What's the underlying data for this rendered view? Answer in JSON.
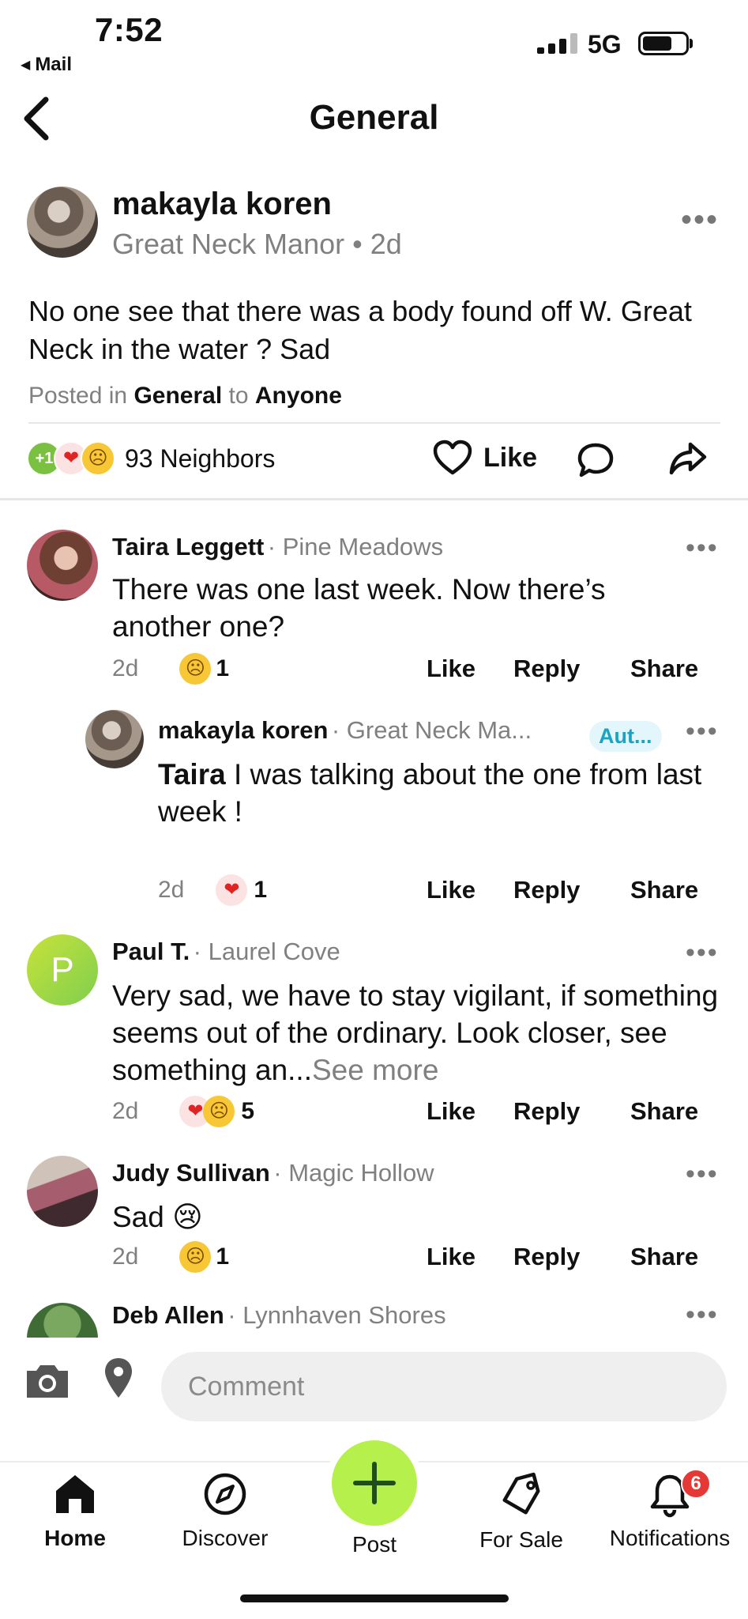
{
  "status_bar": {
    "time": "7:52",
    "back_app": "Mail",
    "network": "5G"
  },
  "header": {
    "title": "General"
  },
  "post": {
    "author": "makayla koren",
    "neighborhood": "Great Neck Manor",
    "age": "2d",
    "body": "No one see that there was a body found off W. Great Neck in the water ? Sad",
    "posted_in_prefix": "Posted in",
    "posted_in_group": "General",
    "posted_to_prefix": "to",
    "audience": "Anyone",
    "reaction_plus": "+1",
    "neighbors_label": "93 Neighbors",
    "like_label": "Like"
  },
  "comments": [
    {
      "name": "Taira Leggett",
      "neighborhood": "· Pine Meadows",
      "text": "There was one last week. Now there’s another one?",
      "age": "2d",
      "reaction_count": "1",
      "like": "Like",
      "reply": "Reply",
      "share": "Share"
    },
    {
      "name": "makayla koren",
      "neighborhood": "· Great Neck Ma...",
      "badge": "Aut...",
      "mention": "Taira",
      "text": " I was talking about the one from last week !",
      "age": "2d",
      "reaction_count": "1",
      "like": "Like",
      "reply": "Reply",
      "share": "Share"
    },
    {
      "name": "Paul T.",
      "neighborhood": "· Laurel Cove",
      "avatar_letter": "P",
      "text": "Very sad, we have to stay vigilant,  if something seems out of the ordinary. Look closer, see something an...",
      "see_more": "See more",
      "age": "2d",
      "reaction_count": "5",
      "like": "Like",
      "reply": "Reply",
      "share": "Share"
    },
    {
      "name": "Judy Sullivan",
      "neighborhood": "· Magic Hollow",
      "text": "Sad 😢",
      "age": "2d",
      "reaction_count": "1",
      "like": "Like",
      "reply": "Reply",
      "share": "Share"
    },
    {
      "name": "Deb Allen",
      "neighborhood": "· Lynnhaven Shores"
    }
  ],
  "composer": {
    "placeholder": "Comment"
  },
  "tabbar": {
    "home": "Home",
    "discover": "Discover",
    "post": "Post",
    "for_sale": "For Sale",
    "notifications": "Notifications",
    "notifications_count": "6"
  },
  "colors": {
    "accent_green": "#b6f04c",
    "badge_red": "#e53935",
    "author_badge": "#1aa3c2"
  }
}
